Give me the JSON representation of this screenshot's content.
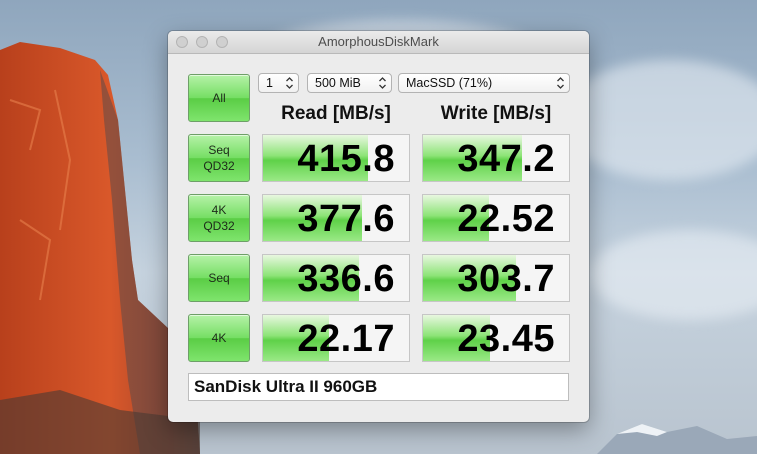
{
  "window": {
    "title": "AmorphousDiskMark"
  },
  "controls": {
    "all_label": "All",
    "count_value": "1",
    "size_value": "500 MiB",
    "drive_value": "MacSSD (71%)"
  },
  "headers": {
    "read": "Read [MB/s]",
    "write": "Write [MB/s]"
  },
  "tests": [
    {
      "label": "Seq\nQD32",
      "read": "415.8",
      "write": "347.2",
      "read_fill": 0.72,
      "write_fill": 0.68
    },
    {
      "label": "4K\nQD32",
      "read": "377.6",
      "write": "22.52",
      "read_fill": 0.68,
      "write_fill": 0.45
    },
    {
      "label": "Seq",
      "read": "336.6",
      "write": "303.7",
      "read_fill": 0.66,
      "write_fill": 0.64
    },
    {
      "label": "4K",
      "read": "22.17",
      "write": "23.45",
      "read_fill": 0.45,
      "write_fill": 0.46
    }
  ],
  "comment": "SanDisk Ultra II 960GB",
  "colors": {
    "button_green": "#75de63",
    "bar_green": "#5fd149"
  },
  "icons": {
    "stepper": "updown-chevron-icon"
  }
}
